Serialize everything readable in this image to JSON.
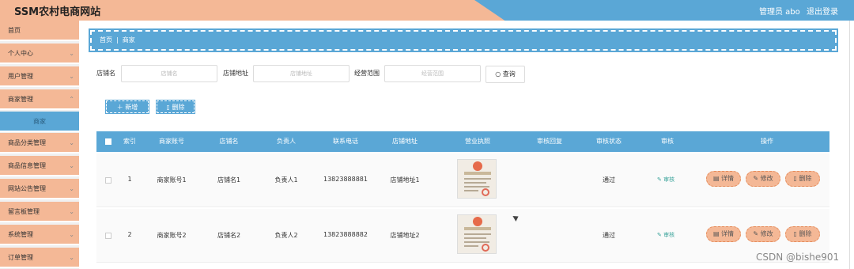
{
  "app": {
    "title": "SSM农村电商网站",
    "admin": "管理员 abo",
    "logout": "退出登录"
  },
  "sidebar": {
    "items": [
      {
        "label": "首页",
        "chevron": false
      },
      {
        "label": "个人中心",
        "chevron": true
      },
      {
        "label": "用户管理",
        "chevron": true
      },
      {
        "label": "商家管理",
        "chevron": true
      },
      {
        "label": "商家",
        "sub": true
      },
      {
        "label": "商品分类管理",
        "chevron": true
      },
      {
        "label": "商品信息管理",
        "chevron": true
      },
      {
        "label": "网站公告管理",
        "chevron": true
      },
      {
        "label": "留言板管理",
        "chevron": true
      },
      {
        "label": "系统管理",
        "chevron": true
      },
      {
        "label": "订单管理",
        "chevron": true
      }
    ]
  },
  "breadcrumb": {
    "home": "首页",
    "sep": "|",
    "current": "商家"
  },
  "search": {
    "shop_name_label": "店铺名",
    "shop_name_placeholder": "店铺名",
    "address_label": "店铺地址",
    "address_placeholder": "店铺地址",
    "scope_label": "经营范围",
    "scope_placeholder": "经营范围",
    "query_label": "查询"
  },
  "actions": {
    "add": "新增",
    "delete": "删除"
  },
  "table": {
    "headers": [
      "索引",
      "商家账号",
      "店铺名",
      "负责人",
      "联系电话",
      "店铺地址",
      "营业执照",
      "审核回复",
      "审核状态",
      "审核",
      "操作"
    ],
    "rows": [
      {
        "index": "1",
        "account": "商家账号1",
        "shop": "店铺名1",
        "owner": "负责人1",
        "phone": "13823888881",
        "address": "店铺地址1",
        "reply": "",
        "status": "通过",
        "audit": "审核",
        "license_title": "营业执照"
      },
      {
        "index": "2",
        "account": "商家账号2",
        "shop": "店铺名2",
        "owner": "负责人2",
        "phone": "13823888882",
        "address": "店铺地址2",
        "reply": "",
        "status": "通过",
        "audit": "审核",
        "license_title": "营业执照"
      }
    ],
    "op_labels": {
      "detail": "详情",
      "edit": "修改",
      "delete": "删除"
    }
  },
  "watermark": "CSDN @bishe901",
  "colors": {
    "peach": "#f4b896",
    "blue": "#5aa7d6"
  },
  "icons": {
    "search": "search-icon",
    "add": "plus-icon",
    "delete": "trash-icon",
    "detail": "doc-icon",
    "edit": "pencil-icon",
    "audit": "pencil-icon"
  }
}
